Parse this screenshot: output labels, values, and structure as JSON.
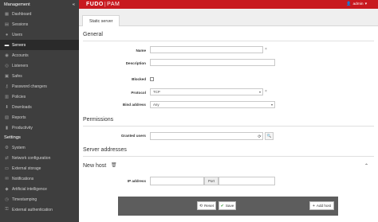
{
  "sidebar": {
    "management_label": "Management",
    "collapse_glyph": "«",
    "management_items": [
      {
        "label": "Dashboard",
        "icon": "dashboard-icon",
        "glyph": "▦"
      },
      {
        "label": "Sessions",
        "icon": "sessions-icon",
        "glyph": "▤"
      },
      {
        "label": "Users",
        "icon": "users-icon",
        "glyph": "●"
      },
      {
        "label": "Servers",
        "icon": "servers-icon",
        "glyph": "▬"
      },
      {
        "label": "Accounts",
        "icon": "accounts-icon",
        "glyph": "◉"
      },
      {
        "label": "Listeners",
        "icon": "listeners-icon",
        "glyph": "◎"
      },
      {
        "label": "Safes",
        "icon": "safes-icon",
        "glyph": "▣"
      },
      {
        "label": "Password changers",
        "icon": "password-changers-icon",
        "glyph": "⚷"
      },
      {
        "label": "Policies",
        "icon": "policies-icon",
        "glyph": "▥"
      },
      {
        "label": "Downloads",
        "icon": "downloads-icon",
        "glyph": "⬇"
      },
      {
        "label": "Reports",
        "icon": "reports-icon",
        "glyph": "▧"
      },
      {
        "label": "Productivity",
        "icon": "productivity-icon",
        "glyph": "▮"
      }
    ],
    "settings_label": "Settings",
    "settings_items": [
      {
        "label": "System",
        "icon": "system-icon",
        "glyph": "⚙"
      },
      {
        "label": "Network configuration",
        "icon": "network-icon",
        "glyph": "⇄"
      },
      {
        "label": "External storage",
        "icon": "storage-icon",
        "glyph": "▭"
      },
      {
        "label": "Notifications",
        "icon": "notifications-icon",
        "glyph": "✉"
      },
      {
        "label": "Artificial intelligence",
        "icon": "ai-icon",
        "glyph": "◆"
      },
      {
        "label": "Timestamping",
        "icon": "timestamping-icon",
        "glyph": "◷"
      },
      {
        "label": "External authentication",
        "icon": "external-auth-icon",
        "glyph": "⚿"
      }
    ]
  },
  "topbar": {
    "logo_left": "FUDO",
    "logo_sep": "|",
    "logo_right": "PAM",
    "user_label": "admin",
    "user_caret": "▾",
    "brand_color": "#c8191f"
  },
  "tab": {
    "label": "Static server"
  },
  "general": {
    "title": "General",
    "name_label": "Name",
    "name_value": "",
    "description_label": "Description",
    "description_value": "",
    "blocked_label": "Blocked",
    "protocol_label": "Protocol",
    "protocol_value": "TCP",
    "bind_address_label": "Bind address",
    "bind_address_value": "Any",
    "clear_glyph": "×",
    "select_arrow": "▾"
  },
  "permissions": {
    "title": "Permissions",
    "granted_users_label": "Granted users",
    "granted_users_value": "",
    "refresh_glyph": "⟳",
    "search_glyph": "🔍"
  },
  "server_addresses": {
    "title": "Server addresses",
    "new_host_label": "New host",
    "trash_glyph": "🗑",
    "collapse_glyph": "⌃",
    "ip_label": "IP address",
    "ip_value": "",
    "port_label": "Port",
    "port_value": ""
  },
  "footer": {
    "reset_label": "Reset",
    "reset_glyph": "⟲",
    "save_label": "Save",
    "save_glyph": "✔",
    "add_host_label": "Add host",
    "add_host_glyph": "+"
  }
}
